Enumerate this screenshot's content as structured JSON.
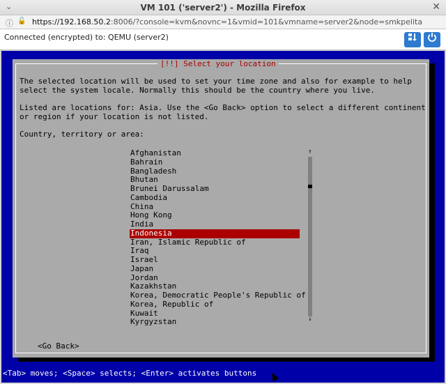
{
  "window": {
    "title": "VM 101 ('server2') - Mozilla Firefox",
    "menu_icon": "chevron-down-icon",
    "close_icon": "close-icon"
  },
  "urlbar": {
    "host": "https://192.168.50.2",
    "path": ":8006/?console=kvm&novnc=1&vmid=101&vmname=server2&node=smkpelita"
  },
  "vnc": {
    "status": "Connected (encrypted) to: QEMU (server2)",
    "send_keys_icon": "keyboard-send-icon",
    "power_icon": "power-icon",
    "accent": "#2e7bcf"
  },
  "dialog": {
    "title": "[!!] Select your location",
    "para1_line1": "The selected location will be used to set your time zone and also for example to help",
    "para1_line2": "select the system locale. Normally this should be the country where you live.",
    "para2_line1": "Listed are locations for: Asia. Use the <Go Back> option to select a different continent",
    "para2_line2": "or region if your location is not listed.",
    "prompt": "Country, territory or area:",
    "countries": [
      "Afghanistan",
      "Bahrain",
      "Bangladesh",
      "Bhutan",
      "Brunei Darussalam",
      "Cambodia",
      "China",
      "Hong Kong",
      "India",
      "Indonesia",
      "Iran, Islamic Republic of",
      "Iraq",
      "Israel",
      "Japan",
      "Jordan",
      "Kazakhstan",
      "Korea, Democratic People's Republic of",
      "Korea, Republic of",
      "Kuwait",
      "Kyrgyzstan"
    ],
    "selected": "Indonesia",
    "scroll_up": "↑",
    "scroll_down": "↓",
    "go_back": "<Go Back>"
  },
  "footer": {
    "hint": "<Tab> moves; <Space> selects; <Enter> activates buttons"
  },
  "colors": {
    "screen_bg": "#0000a8",
    "dialog_bg": "#aaaaaa",
    "selection_bg": "#aa0000",
    "title_fg": "#aa0000"
  }
}
